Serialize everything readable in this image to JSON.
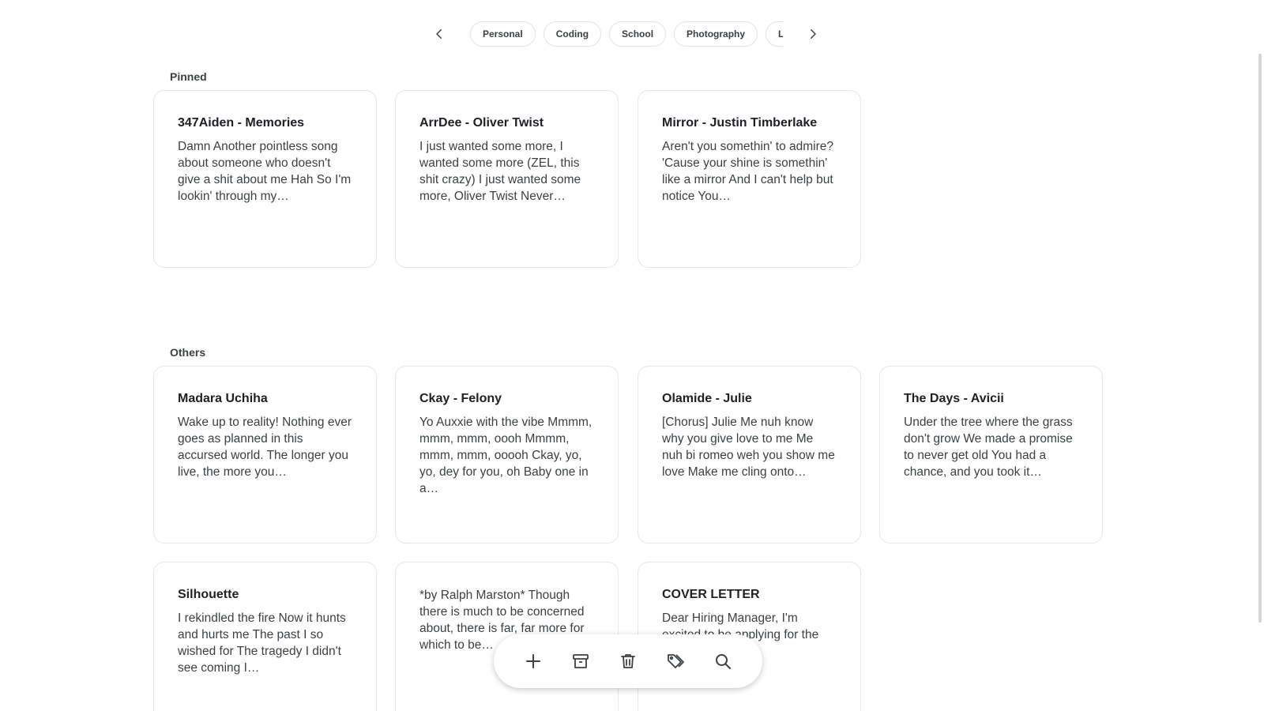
{
  "chips": [
    "Personal",
    "Coding",
    "School",
    "Photography",
    "Lyrics"
  ],
  "sections": {
    "pinned": "Pinned",
    "others": "Others"
  },
  "pinned": [
    {
      "title": "347Aiden - Memories",
      "body": "Damn Another pointless song about someone who doesn't give a shit about me Hah So I'm lookin' through my…"
    },
    {
      "title": "ArrDee - Oliver Twist",
      "body": "I just wanted some more, I wanted some more (ZEL, this shit crazy) I just wanted some more, Oliver Twist Never…"
    },
    {
      "title": "Mirror - Justin Timberlake",
      "body": "Aren't you somethin' to admire? 'Cause your shine is somethin' like a mirror And I can't help but notice You…"
    }
  ],
  "others": [
    {
      "title": "Madara Uchiha",
      "body": "Wake up to reality! Nothing ever goes as planned in this accursed world. The longer you live, the more you…"
    },
    {
      "title": "Ckay - Felony",
      "body": "Yo Auxxie with the vibe Mmmm, mmm, mmm, oooh Mmmm, mmm, mmm, ooooh Ckay, yo, yo, dey for you, oh Baby one in a…"
    },
    {
      "title": "Olamide - Julie",
      "body": "[Chorus] Julie Me nuh know why you give love to me Me nuh bi romeo weh you show me love Make me cling onto…"
    },
    {
      "title": "The Days - Avicii",
      "body": "Under the tree where the grass don't grow We made a promise to never get old You had a chance, and you took it…"
    },
    {
      "title": "Silhouette",
      "body": "I rekindled the fire Now it hunts and hurts me The past I so wished for The tragedy I didn't see coming I…"
    },
    {
      "title": "",
      "body": "*by Ralph Marston* Though there is much to be concerned about, there is far, far more for which to be…"
    },
    {
      "title": "COVER LETTER",
      "body": "Dear Hiring Manager, I'm excited to be applying for the position at As…"
    }
  ],
  "icons": {
    "prev": "chevron-left-icon",
    "next": "chevron-right-icon",
    "add": "plus-icon",
    "archive": "archive-icon",
    "trash": "trash-icon",
    "labels": "tags-icon",
    "search": "search-icon"
  }
}
